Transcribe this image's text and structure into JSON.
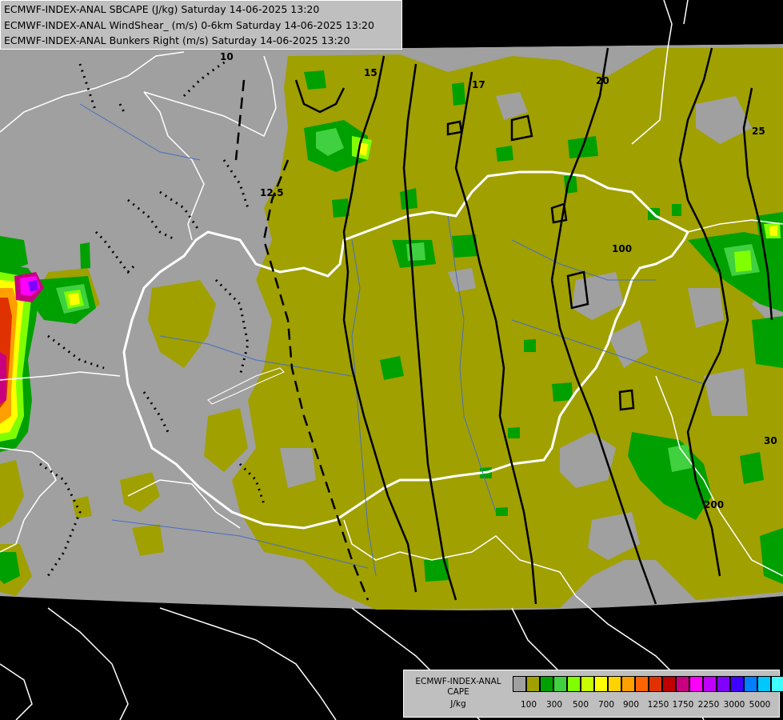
{
  "titles": [
    "ECMWF-INDEX-ANAL SBCAPE (J/kg) Saturday 14-06-2025 13:20",
    "ECMWF-INDEX-ANAL WindShear_ (m/s) 0-6km Saturday 14-06-2025 13:20",
    "ECMWF-INDEX-ANAL Bunkers Right (m/s) Saturday 14-06-2025 13:20"
  ],
  "legend": {
    "model": "ECMWF-INDEX-ANAL",
    "field": "CAPE",
    "unit": "J/kg",
    "colors": [
      "#a0a0a0",
      "#a0a000",
      "#00a000",
      "#40d040",
      "#80ff00",
      "#c8ff00",
      "#ffff00",
      "#ffd200",
      "#ffa000",
      "#ff6400",
      "#e03200",
      "#c00000",
      "#c80080",
      "#ff00ff",
      "#c000ff",
      "#8000ff",
      "#4000ff",
      "#0080ff",
      "#00c8ff",
      "#40ffff",
      "#c0ffff",
      "#ffffff"
    ],
    "tick_labels": [
      "100",
      "300",
      "500",
      "700",
      "900",
      "1250",
      "1750",
      "2250",
      "3000",
      "5000"
    ]
  },
  "contour_labels": [
    {
      "text": "10",
      "kind": "windshear"
    },
    {
      "text": "12.5",
      "kind": "windshear"
    },
    {
      "text": "15",
      "kind": "windshear"
    },
    {
      "text": "17",
      "kind": "windshear"
    },
    {
      "text": "20",
      "kind": "windshear"
    },
    {
      "text": "25",
      "kind": "windshear"
    },
    {
      "text": "30",
      "kind": "windshear"
    },
    {
      "text": "100",
      "kind": "cape"
    },
    {
      "text": "200",
      "kind": "cape"
    }
  ],
  "map": {
    "region": "Hungary and surrounding Central Europe",
    "background_color": "#000000",
    "data_area_color": "#a0a0a0",
    "border_color": "#ffffff"
  }
}
